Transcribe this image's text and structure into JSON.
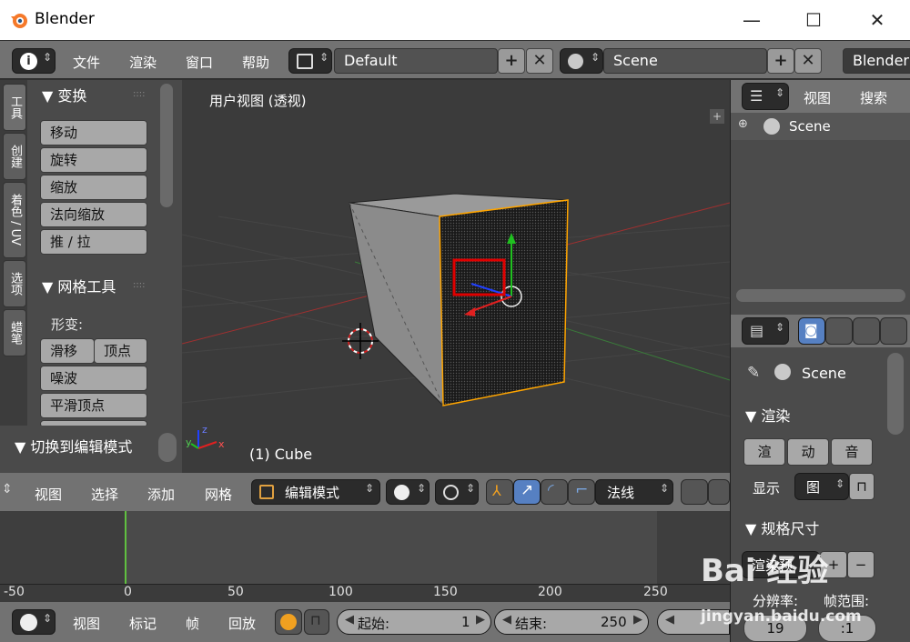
{
  "window": {
    "title": "Blender",
    "minimize": "—",
    "maximize": "☐",
    "close": "✕"
  },
  "menubar": {
    "info_icon": "i",
    "menus": [
      "文件",
      "渲染",
      "窗口",
      "帮助"
    ],
    "screen_layout": "Default",
    "scene": "Scene",
    "engine": "Blender"
  },
  "toolshelf": {
    "tabs": [
      "工具",
      "创建",
      "着色 / UV",
      "选项",
      "蜡笔"
    ],
    "transform_header": "▼ 变换",
    "transform_buttons": [
      "移动",
      "旋转",
      "缩放",
      "法向缩放",
      "推 / 拉"
    ],
    "mesh_tools_header": "▼ 网格工具",
    "deform_label": "形变:",
    "deform_buttons": [
      "滑移",
      "顶点"
    ],
    "more_buttons": [
      "噪波",
      "平滑顶点"
    ],
    "edit_mode_panel": "▼ 切换到编辑模式"
  },
  "viewport": {
    "view_label": "用户视图 (透视)",
    "object_label": "(1) Cube",
    "colors": {
      "selected_edge": "#ffa500",
      "highlight_box": "#e00000",
      "gizmo_x": "#e02020",
      "gizmo_y": "#20c020",
      "gizmo_z": "#2040ff"
    }
  },
  "viewport_header": {
    "menus": [
      "视图",
      "选择",
      "添加",
      "网格"
    ],
    "mode": "编辑模式",
    "orientation": "法线"
  },
  "timeline": {
    "ruler_ticks": [
      "-50",
      "0",
      "50",
      "100",
      "150",
      "200",
      "250"
    ],
    "menus": [
      "视图",
      "标记",
      "帧",
      "回放"
    ],
    "start_label": "起始:",
    "start_value": "1",
    "end_label": "结束:",
    "end_value": "250"
  },
  "outliner": {
    "menus": [
      "视图",
      "搜索"
    ],
    "item": "Scene"
  },
  "properties": {
    "context": "Scene",
    "render_header": "▼ 渲染",
    "render_buttons": [
      "渲",
      "动",
      "音"
    ],
    "display_label": "显示",
    "display_value": "图",
    "dimensions_header": "▼ 规格尺寸",
    "preset_label": "渲染预",
    "resolution_label": "分辨率:",
    "frame_range_label": "帧范围:",
    "res_value": "19",
    "frame_value": ":1"
  },
  "watermark": {
    "text": "Bai 经验",
    "url": "jingyan.baidu.com"
  }
}
